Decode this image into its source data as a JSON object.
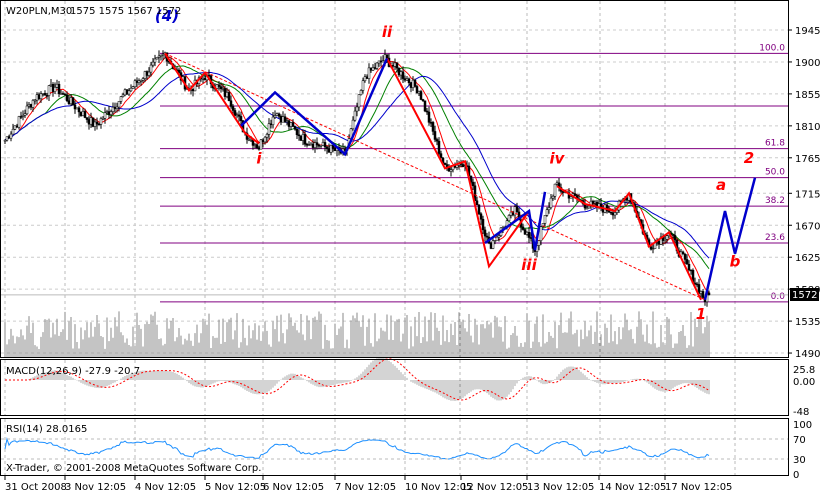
{
  "header": {
    "symbol": "W20PLN,M30",
    "ohlc": "1575 1575 1567 1572"
  },
  "current_price": "1572",
  "copyright": "X-Trader, © 2001-2008 MetaQuotes Software Corp.",
  "colors": {
    "bull_wave": "#0000cc",
    "bear_wave": "#ff0000",
    "fib": "#800080",
    "ma_fast": "#ff0000",
    "ma_mid": "#008000",
    "ma_slow": "#0000cc",
    "rsi": "#1e90ff"
  },
  "chart_data": {
    "type": "candlestick",
    "price_axis": {
      "ticks": [
        "1945",
        "1900",
        "1855",
        "1810",
        "1765",
        "1715",
        "1670",
        "1625",
        "1580",
        "1535",
        "1490"
      ],
      "range": [
        1490,
        1945
      ]
    },
    "time_labels": [
      {
        "bar": 0,
        "label": "31 Oct 2008"
      },
      {
        "bar": 30,
        "label": "3 Nov 12:05"
      },
      {
        "bar": 65,
        "label": "4 Nov 12:05"
      },
      {
        "bar": 100,
        "label": "5 Nov 12:05"
      },
      {
        "bar": 129,
        "label": "6 Nov 12:05"
      },
      {
        "bar": 165,
        "label": "7 Nov 12:05"
      },
      {
        "bar": 200,
        "label": "10 Nov 12:05"
      },
      {
        "bar": 228,
        "label": "12 Nov 12:05"
      },
      {
        "bar": 261,
        "label": "13 Nov 12:05"
      },
      {
        "bar": 297,
        "label": "14 Nov 12:05"
      },
      {
        "bar": 330,
        "label": "17 Nov 12:05"
      }
    ],
    "price_path": [
      [
        0,
        1790
      ],
      [
        15,
        1850
      ],
      [
        25,
        1865
      ],
      [
        45,
        1810
      ],
      [
        55,
        1840
      ],
      [
        80,
        1912
      ],
      [
        92,
        1860
      ],
      [
        100,
        1880
      ],
      [
        112,
        1850
      ],
      [
        120,
        1800
      ],
      [
        127,
        1780
      ],
      [
        135,
        1830
      ],
      [
        150,
        1790
      ],
      [
        170,
        1770
      ],
      [
        180,
        1880
      ],
      [
        190,
        1905
      ],
      [
        207,
        1860
      ],
      [
        220,
        1750
      ],
      [
        230,
        1760
      ],
      [
        242,
        1640
      ],
      [
        255,
        1690
      ],
      [
        265,
        1635
      ],
      [
        275,
        1725
      ],
      [
        290,
        1700
      ],
      [
        305,
        1690
      ],
      [
        312,
        1715
      ],
      [
        322,
        1640
      ],
      [
        332,
        1660
      ],
      [
        345,
        1590
      ],
      [
        350,
        1565
      ],
      [
        352,
        1572
      ]
    ],
    "fib_levels": [
      {
        "label": "100.0",
        "price": 1912
      },
      {
        "label": "",
        "price": 1838
      },
      {
        "label": "61.8",
        "price": 1778
      },
      {
        "label": "50.0",
        "price": 1737
      },
      {
        "label": "38.2",
        "price": 1697
      },
      {
        "label": "23.6",
        "price": 1645
      },
      {
        "label": "0.0",
        "price": 1562
      }
    ],
    "wave_labels": [
      {
        "text": "(4)",
        "bar": 81,
        "price": 1958,
        "color": "blue"
      },
      {
        "text": "ii",
        "bar": 191,
        "price": 1935,
        "color": "red"
      },
      {
        "text": "i",
        "bar": 127,
        "price": 1757,
        "color": "red"
      },
      {
        "text": "iii",
        "bar": 262,
        "price": 1607,
        "color": "red"
      },
      {
        "text": "iv",
        "bar": 276,
        "price": 1757,
        "color": "red"
      },
      {
        "text": "1",
        "bar": 348,
        "price": 1538,
        "color": "red"
      },
      {
        "text": "a",
        "bar": 358,
        "price": 1720,
        "color": "red"
      },
      {
        "text": "b",
        "bar": 365,
        "price": 1612,
        "color": "red"
      },
      {
        "text": "2",
        "bar": 372,
        "price": 1758,
        "color": "red"
      }
    ],
    "blue_waves": [
      [
        [
          118,
          1810
        ],
        [
          135,
          1857
        ],
        [
          170,
          1770
        ],
        [
          191,
          1905
        ]
      ],
      [
        [
          240,
          1645
        ],
        [
          262,
          1690
        ],
        [
          265,
          1635
        ],
        [
          270,
          1717
        ]
      ],
      [
        [
          350,
          1565
        ],
        [
          360,
          1690
        ],
        [
          365,
          1630
        ],
        [
          375,
          1737
        ]
      ]
    ],
    "red_waves": [
      [
        [
          80,
          1912
        ],
        [
          92,
          1860
        ],
        [
          100,
          1885
        ],
        [
          120,
          1800
        ],
        [
          127,
          1785
        ]
      ],
      [
        [
          191,
          1905
        ],
        [
          220,
          1750
        ],
        [
          230,
          1760
        ],
        [
          242,
          1612
        ],
        [
          262,
          1690
        ]
      ],
      [
        [
          276,
          1725
        ],
        [
          290,
          1700
        ],
        [
          305,
          1690
        ],
        [
          312,
          1715
        ],
        [
          322,
          1640
        ],
        [
          332,
          1660
        ],
        [
          348,
          1565
        ]
      ]
    ],
    "trend_line": [
      [
        80,
        1912
      ],
      [
        350,
        1565
      ]
    ],
    "macd": {
      "label": "MACD(12,26,9) -27.9 -20.7",
      "ticks": [
        "25.8",
        "0.00",
        "-48"
      ]
    },
    "rsi": {
      "label": "RSI(14) 28.0165",
      "ticks": [
        "100",
        "70",
        "30",
        "0"
      ]
    }
  }
}
